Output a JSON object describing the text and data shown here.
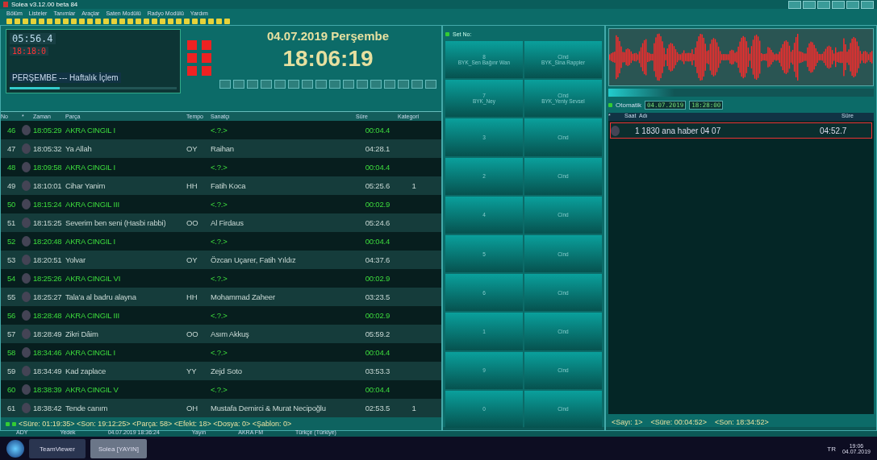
{
  "window": {
    "title": "Solea v3.12.00 beta 84"
  },
  "menu": [
    "Bölüm",
    "Listeler",
    "Tanımlar",
    "Araçlar",
    "Saten Modülü",
    "Radyo Modülü",
    "Yardım"
  ],
  "player": {
    "elapsed": "05:56.4",
    "remaining": "18:18:0",
    "title": "PERŞEMBE --- Haftalık İçlem",
    "level": 0.3
  },
  "clock": {
    "date": "04.07.2019  Perşembe",
    "time": "18:06:19"
  },
  "playlist": {
    "columns": [
      "No",
      "*",
      "Zaman",
      "Parça",
      "Tempo",
      "Sanatçı",
      "Süre",
      "Kategori"
    ],
    "rows": [
      {
        "no": "46",
        "time": "18:05:29",
        "title": "AKRA CINGIL I",
        "tempo": "",
        "artist": "<.?.>",
        "duration": "00:04.4",
        "category": "",
        "kind": "jingle"
      },
      {
        "no": "47",
        "time": "18:05:32",
        "title": "Ya Allah",
        "tempo": "OY",
        "artist": "Raihan",
        "duration": "04:28.1",
        "category": "",
        "kind": "song"
      },
      {
        "no": "48",
        "time": "18:09:58",
        "title": "AKRA CINGIL I",
        "tempo": "",
        "artist": "<.?.>",
        "duration": "00:04.4",
        "category": "",
        "kind": "jingle"
      },
      {
        "no": "49",
        "time": "18:10:01",
        "title": "Cihar Yanim",
        "tempo": "HH",
        "artist": "Fatih Koca",
        "duration": "05:25.6",
        "category": "1",
        "kind": "song"
      },
      {
        "no": "50",
        "time": "18:15:24",
        "title": "AKRA CINGIL III",
        "tempo": "",
        "artist": "<.?.>",
        "duration": "00:02.9",
        "category": "",
        "kind": "jingle"
      },
      {
        "no": "51",
        "time": "18:15:25",
        "title": "Severim ben seni (Hasbi rabbi)",
        "tempo": "OO",
        "artist": "Al Firdaus",
        "duration": "05:24.6",
        "category": "",
        "kind": "song"
      },
      {
        "no": "52",
        "time": "18:20:48",
        "title": "AKRA CINGIL I",
        "tempo": "",
        "artist": "<.?.>",
        "duration": "00:04.4",
        "category": "",
        "kind": "jingle"
      },
      {
        "no": "53",
        "time": "18:20:51",
        "title": "Yolvar",
        "tempo": "OY",
        "artist": "Özcan Uçarer, Fatih Yıldız",
        "duration": "04:37.6",
        "category": "",
        "kind": "song"
      },
      {
        "no": "54",
        "time": "18:25:26",
        "title": "AKRA CINGIL VI",
        "tempo": "",
        "artist": "<.?.>",
        "duration": "00:02.9",
        "category": "",
        "kind": "jingle"
      },
      {
        "no": "55",
        "time": "18:25:27",
        "title": "Tala'a al badru alayna",
        "tempo": "HH",
        "artist": "Mohammad Zaheer",
        "duration": "03:23.5",
        "category": "",
        "kind": "song"
      },
      {
        "no": "56",
        "time": "18:28:48",
        "title": "AKRA CINGIL III",
        "tempo": "",
        "artist": "<.?.>",
        "duration": "00:02.9",
        "category": "",
        "kind": "jingle"
      },
      {
        "no": "57",
        "time": "18:28:49",
        "title": "Zikri Dâim",
        "tempo": "OO",
        "artist": "Asım Akkuş",
        "duration": "05:59.2",
        "category": "",
        "kind": "song"
      },
      {
        "no": "58",
        "time": "18:34:46",
        "title": "AKRA CINGIL I",
        "tempo": "",
        "artist": "<.?.>",
        "duration": "00:04.4",
        "category": "",
        "kind": "jingle"
      },
      {
        "no": "59",
        "time": "18:34:49",
        "title": "Kad zaplace",
        "tempo": "YY",
        "artist": "Zejd Soto",
        "duration": "03:53.3",
        "category": "",
        "kind": "song"
      },
      {
        "no": "60",
        "time": "18:38:39",
        "title": "AKRA CINGIL V",
        "tempo": "",
        "artist": "<.?.>",
        "duration": "00:04.4",
        "category": "",
        "kind": "jingle"
      },
      {
        "no": "61",
        "time": "18:38:42",
        "title": "Tende canım",
        "tempo": "OH",
        "artist": "Mustafa Demirci & Murat Necipoğlu",
        "duration": "02:53.5",
        "category": "1",
        "kind": "song"
      }
    ],
    "footer": "<Süre: 01:19:35> <Son: 19:12:25> <Parça: 58> <Efekt: 18> <Dosya: 0> <Şablon: 0>"
  },
  "carts": {
    "label": "Set No:",
    "items": [
      {
        "number": "8",
        "name": "BYK_Sen Bağırır Wan"
      },
      {
        "number": "Cind",
        "name": "BYK_Sina Rappler"
      },
      {
        "number": "7",
        "name": "BYK_Ney"
      },
      {
        "number": "Cind",
        "name": "BYK_Yeniy Sevsel"
      },
      {
        "number": "3"
      },
      {
        "number": "Cind"
      },
      {
        "number": "2"
      },
      {
        "number": "Cind"
      },
      {
        "number": "4"
      },
      {
        "number": "Cind"
      },
      {
        "number": "5"
      },
      {
        "number": "Cind"
      },
      {
        "number": "6"
      },
      {
        "number": "Cind"
      },
      {
        "number": "1"
      },
      {
        "number": "Cind"
      },
      {
        "number": "9"
      },
      {
        "number": "Cind"
      },
      {
        "number": "0"
      },
      {
        "number": "Cind"
      }
    ]
  },
  "waveform": {
    "level": 0.25
  },
  "queue": {
    "mode": "Otomatik",
    "date": "04.07.2019",
    "time": "18:28:00",
    "columns": [
      "*",
      "Saat",
      "Adı",
      "Süre"
    ],
    "rows": [
      {
        "title": "1 1830 ana haber 04 07",
        "duration": "04:52.7",
        "selected": true
      }
    ],
    "footer": [
      "<Sayı: 1>",
      "<Süre: 00:04:52>",
      "<Son: 18:34:52>"
    ]
  },
  "status_bar": [
    "ADY",
    "Yedek",
    "04.07.2019 18:36:24",
    "Yayın",
    "AKRA FM",
    "Türkçe (Türkiye)"
  ],
  "taskbar": {
    "apps": [
      {
        "label": "TeamViewer",
        "selected": false
      },
      {
        "label": "Solea [YAYIN]",
        "selected": true
      }
    ],
    "language": "TR",
    "time": "19:06",
    "date": "04.07.2019"
  }
}
